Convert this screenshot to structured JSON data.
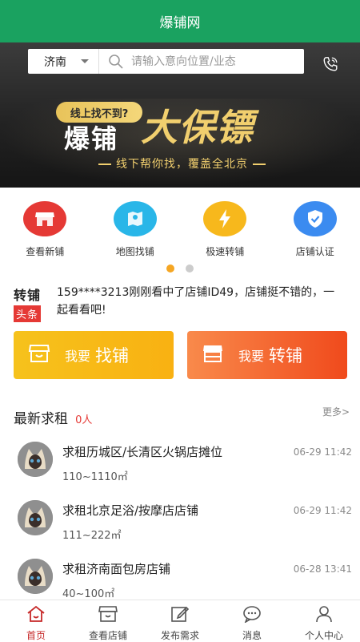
{
  "app": {
    "title": "爆铺网"
  },
  "search": {
    "city": "济南",
    "placeholder": "请输入意向位置/业态"
  },
  "banner": {
    "tagline": "线上找不到?",
    "brand": "爆铺",
    "slogan_big": "大保镖",
    "subtitle": "线下帮你找，覆盖全北京"
  },
  "quick_actions": [
    {
      "label": "查看新铺",
      "icon": "shop-icon",
      "color": "#e53935"
    },
    {
      "label": "地图找铺",
      "icon": "map-icon",
      "color": "#29b6e8"
    },
    {
      "label": "极速转铺",
      "icon": "lightning-icon",
      "color": "#f7b81c"
    },
    {
      "label": "店铺认证",
      "icon": "shield-check-icon",
      "color": "#3b8bf0"
    }
  ],
  "news": {
    "logo_top": "转铺",
    "logo_tag": "头条",
    "text": "159****3213刚刚看中了店铺ID49，店铺挺不错的，一起看看吧!"
  },
  "buttons": {
    "find": {
      "small": "我要",
      "big": "找铺"
    },
    "transfer": {
      "small": "我要",
      "big": "转铺"
    }
  },
  "section": {
    "title": "最新求租",
    "count": "0人",
    "more": "更多>"
  },
  "rent_requests": [
    {
      "title": "求租历城区/长清区火锅店摊位",
      "area": "110~1110㎡",
      "time": "06-29 11:42"
    },
    {
      "title": "求租北京足浴/按摩店店铺",
      "area": "111~222㎡",
      "time": "06-29 11:42"
    },
    {
      "title": "求租济南面包房店铺",
      "area": "40~100㎡",
      "time": "06-28 13:41"
    }
  ],
  "tabs": [
    {
      "label": "首页",
      "icon": "home-icon",
      "active": true
    },
    {
      "label": "查看店铺",
      "icon": "store-icon",
      "active": false
    },
    {
      "label": "发布需求",
      "icon": "edit-icon",
      "active": false
    },
    {
      "label": "消息",
      "icon": "chat-icon",
      "active": false
    },
    {
      "label": "个人中心",
      "icon": "user-icon",
      "active": false
    }
  ],
  "colors": {
    "primary": "#1aa260",
    "accent_red": "#c62828",
    "gold": "#f1cf6e"
  }
}
